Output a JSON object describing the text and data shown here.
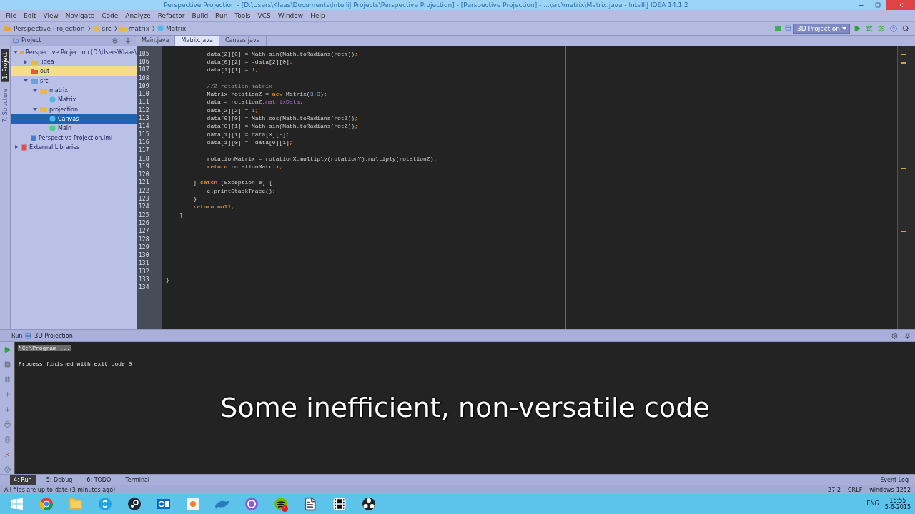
{
  "window": {
    "title": "Perspective Projection - [D:\\Users\\Klaas\\Documents\\IntelliJ Projects\\Perspective Projection] - [Perspective Projection] - ...\\src\\matrix\\Matrix.java - IntelliJ IDEA 14.1.2"
  },
  "menu": [
    "File",
    "Edit",
    "View",
    "Navigate",
    "Code",
    "Analyze",
    "Refactor",
    "Build",
    "Run",
    "Tools",
    "VCS",
    "Window",
    "Help"
  ],
  "breadcrumbs": [
    {
      "label": "Perspective Projection",
      "kind": "project"
    },
    {
      "label": "src",
      "kind": "folder"
    },
    {
      "label": "matrix",
      "kind": "package"
    },
    {
      "label": "Matrix",
      "kind": "class"
    }
  ],
  "run_config": {
    "label": "3D Projection"
  },
  "side_tools": [
    {
      "label": "1: Project",
      "selected": true
    },
    {
      "label": "7: Structure",
      "selected": false
    }
  ],
  "project_panel": {
    "title": "Project"
  },
  "editor_tabs": [
    {
      "label": "Main.java",
      "selected": false
    },
    {
      "label": "Matrix.java",
      "selected": true
    },
    {
      "label": "Canvas.java",
      "selected": false
    }
  ],
  "tree": [
    {
      "label": "Perspective Projection (D:\\Users\\Klaas\\",
      "kind": "project",
      "expanded": true,
      "selected": false,
      "children": [
        {
          "label": ".idea",
          "kind": "folder",
          "expanded": false,
          "selected": false
        },
        {
          "label": "out",
          "kind": "excluded",
          "selected": false
        },
        {
          "label": "src",
          "kind": "source",
          "expanded": true,
          "selected": false,
          "children": [
            {
              "label": "matrix",
              "kind": "package",
              "expanded": true,
              "selected": false,
              "children": [
                {
                  "label": "Matrix",
                  "kind": "class",
                  "selected": false
                }
              ]
            },
            {
              "label": "projection",
              "kind": "package",
              "expanded": true,
              "selected": false,
              "children": [
                {
                  "label": "Canvas",
                  "kind": "class",
                  "selected": true
                },
                {
                  "label": "Main",
                  "kind": "main",
                  "selected": false
                }
              ]
            }
          ]
        },
        {
          "label": "Perspective Projection.iml",
          "kind": "iml",
          "selected": false
        }
      ]
    },
    {
      "label": "External Libraries",
      "kind": "library",
      "expanded": false,
      "selected": false
    }
  ],
  "code_lines": [
    {
      "number": "105",
      "tokens": [
        {
          "text": "            data[2][0] = Math.sin(Math.toRadians(rotY))",
          "kind": "plain"
        },
        {
          "text": ";",
          "kind": "keyword"
        }
      ]
    },
    {
      "number": "106",
      "tokens": [
        {
          "text": "            data[0][2] = -data[2][0]",
          "kind": "plain"
        },
        {
          "text": ";",
          "kind": "keyword"
        }
      ]
    },
    {
      "number": "107",
      "tokens": [
        {
          "text": "            data[1][1] = ",
          "kind": "plain"
        },
        {
          "text": "1",
          "kind": "number"
        },
        {
          "text": ";",
          "kind": "keyword"
        }
      ]
    },
    {
      "number": "108"
    },
    {
      "number": "109",
      "tokens": [
        {
          "text": "            //Z rotation matrix",
          "kind": "comment"
        }
      ]
    },
    {
      "number": "110",
      "tokens": [
        {
          "text": "            Matrix rotationZ = ",
          "kind": "plain"
        },
        {
          "text": "new",
          "kind": "keyword"
        },
        {
          "text": " Matrix(",
          "kind": "plain"
        },
        {
          "text": "3",
          "kind": "number"
        },
        {
          "text": ",",
          "kind": "keyword"
        },
        {
          "text": "3",
          "kind": "number"
        },
        {
          "text": ")",
          "kind": "plain"
        },
        {
          "text": ";",
          "kind": "keyword"
        }
      ]
    },
    {
      "number": "111",
      "tokens": [
        {
          "text": "            data = rotationZ.",
          "kind": "plain"
        },
        {
          "text": "matrixData",
          "kind": "field"
        },
        {
          "text": ";",
          "kind": "keyword"
        }
      ]
    },
    {
      "number": "112",
      "tokens": [
        {
          "text": "            data[2][2] = ",
          "kind": "plain"
        },
        {
          "text": "1",
          "kind": "number"
        },
        {
          "text": ";",
          "kind": "keyword"
        }
      ]
    },
    {
      "number": "113",
      "tokens": [
        {
          "text": "            data[0][0] = Math.cos(Math.toRadians(rotZ))",
          "kind": "plain"
        },
        {
          "text": ";",
          "kind": "keyword"
        }
      ]
    },
    {
      "number": "114",
      "tokens": [
        {
          "text": "            data[0][1] = Math.sin(Math.toRadians(rotZ))",
          "kind": "plain"
        },
        {
          "text": ";",
          "kind": "keyword"
        }
      ]
    },
    {
      "number": "115",
      "tokens": [
        {
          "text": "            data[1][1] = data[0][0]",
          "kind": "plain"
        },
        {
          "text": ";",
          "kind": "keyword"
        }
      ]
    },
    {
      "number": "116",
      "tokens": [
        {
          "text": "            data[1][0] = -data[0][1]",
          "kind": "plain"
        },
        {
          "text": ";",
          "kind": "keyword"
        }
      ]
    },
    {
      "number": "117"
    },
    {
      "number": "118",
      "tokens": [
        {
          "text": "            rotationMatrix = rotationX.multiply(rotationY).multiply(rotationZ)",
          "kind": "plain"
        },
        {
          "text": ";",
          "kind": "keyword"
        }
      ]
    },
    {
      "number": "119",
      "tokens": [
        {
          "text": "            return",
          "kind": "keyword"
        },
        {
          "text": " rotationMatrix",
          "kind": "plain"
        },
        {
          "text": ";",
          "kind": "keyword"
        }
      ]
    },
    {
      "number": "120"
    },
    {
      "number": "121",
      "tokens": [
        {
          "text": "        } ",
          "kind": "plain"
        },
        {
          "text": "catch",
          "kind": "keyword"
        },
        {
          "text": " (Exception e) {",
          "kind": "plain"
        }
      ]
    },
    {
      "number": "122",
      "tokens": [
        {
          "text": "            e.printStackTrace()",
          "kind": "plain"
        },
        {
          "text": ";",
          "kind": "keyword"
        }
      ]
    },
    {
      "number": "123",
      "tokens": [
        {
          "text": "        }",
          "kind": "plain"
        }
      ]
    },
    {
      "number": "124",
      "tokens": [
        {
          "text": "        return null",
          "kind": "keyword"
        },
        {
          "text": ";",
          "kind": "keyword"
        }
      ]
    },
    {
      "number": "125",
      "tokens": [
        {
          "text": "    }",
          "kind": "plain"
        }
      ]
    },
    {
      "number": "126"
    },
    {
      "number": "127"
    },
    {
      "number": "128"
    },
    {
      "number": "129"
    },
    {
      "number": "130"
    },
    {
      "number": "131"
    },
    {
      "number": "132"
    },
    {
      "number": "133",
      "tokens": [
        {
          "text": "}",
          "kind": "plain"
        }
      ]
    },
    {
      "number": "134"
    }
  ],
  "run_panel": {
    "title": "Run",
    "tab": "3D Projection",
    "lines": [
      {
        "text": "\"C:\\Program ...",
        "kind": "folded"
      },
      {
        "text": "Process finished with exit code 0",
        "kind": "plain"
      }
    ]
  },
  "caption": "Some inefficient, non-versatile code",
  "bottom_tools": [
    {
      "label": "4: Run",
      "selected": true
    },
    {
      "label": "5: Debug",
      "selected": false
    },
    {
      "label": "6: TODO",
      "selected": false
    },
    {
      "label": "Terminal",
      "selected": false
    }
  ],
  "event_log": "Event Log",
  "status_bar": {
    "message": "All files are up-to-date (3 minutes ago)",
    "position": "27:2",
    "line_separator": "CRLF",
    "encoding": "windows-1252"
  },
  "taskbar": {
    "apps": [
      {
        "kind": "browser"
      },
      {
        "kind": "folder"
      },
      {
        "kind": "chat"
      },
      {
        "kind": "game"
      },
      {
        "kind": "mail"
      },
      {
        "kind": "app"
      },
      {
        "kind": "dolphin"
      },
      {
        "kind": "torrent"
      },
      {
        "kind": "music",
        "badge": "1"
      },
      {
        "kind": "notepad"
      },
      {
        "kind": "film"
      },
      {
        "kind": "recorder"
      }
    ],
    "language": "ENG",
    "time": "16:55",
    "date": "5-6-2015"
  }
}
